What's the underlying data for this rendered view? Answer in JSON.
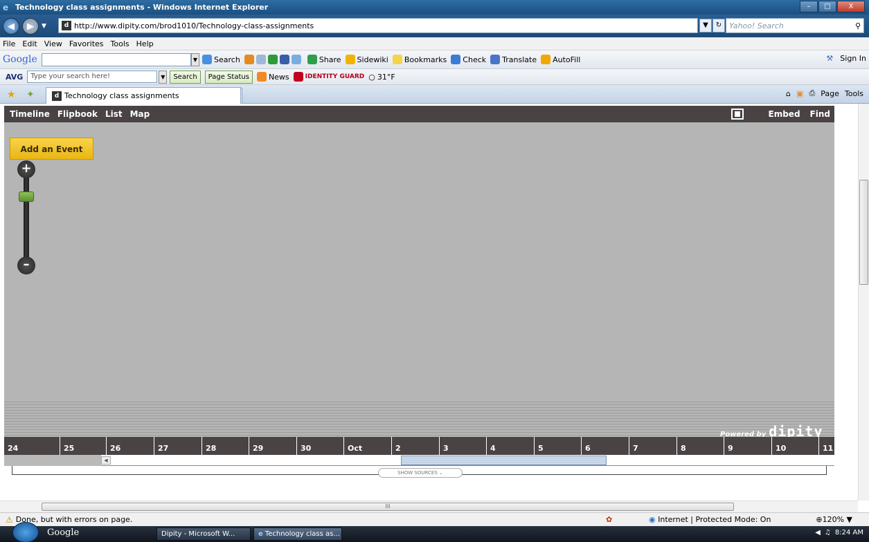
{
  "window": {
    "title": "Technology class assignments - Windows Internet Explorer"
  },
  "address": {
    "url": "http://www.dipity.com/brod1010/Technology-class-assignments",
    "search_placeholder": "Yahoo! Search"
  },
  "menu": [
    "File",
    "Edit",
    "View",
    "Favorites",
    "Tools",
    "Help"
  ],
  "google_toolbar": {
    "logo": "Google",
    "search_label": "Search",
    "share": "Share",
    "sidewiki": "Sidewiki",
    "bookmarks": "Bookmarks",
    "check": "Check",
    "translate": "Translate",
    "autofill": "AutoFill",
    "signin": "Sign In"
  },
  "avg_toolbar": {
    "logo": "AVG",
    "search_placeholder": "Type your search here!",
    "search_button": "Search",
    "page_status": "Page Status",
    "news": "News",
    "identity": "IDENTITY GUARD",
    "weather": "31°F"
  },
  "tab": {
    "title": "Technology class assignments"
  },
  "tab_tools": {
    "page": "Page",
    "tools": "Tools"
  },
  "dipity": {
    "views": [
      "Timeline",
      "Flipbook",
      "List",
      "Map"
    ],
    "embed": "Embed",
    "find": "Find",
    "add_event": "Add an Event",
    "powered_by": "Powered by",
    "brand": "dipity",
    "timeline_labels": [
      "24",
      "25",
      "26",
      "27",
      "28",
      "29",
      "30",
      "Oct",
      "2",
      "3",
      "4",
      "5",
      "6",
      "7",
      "8",
      "9",
      "10",
      "11"
    ],
    "show_sources": "SHOW SOURCES"
  },
  "status": {
    "text": "Done, but with errors on page.",
    "zone": "Internet | Protected Mode: On",
    "zoom": "120%"
  },
  "taskbar": {
    "google": "Google",
    "tasks": [
      "Dipity - Microsoft W...",
      "Technology class as..."
    ],
    "time": "8:24 AM"
  }
}
